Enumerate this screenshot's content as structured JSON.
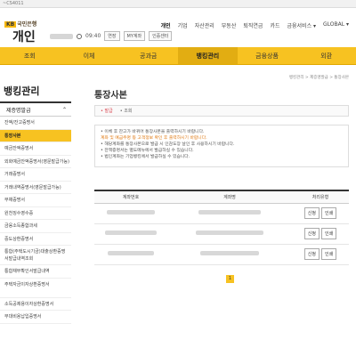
{
  "browser": {
    "url": "~CS4011"
  },
  "header": {
    "logo_badge": "KB",
    "logo_text": "국민은행",
    "brand": "개인",
    "gnb": [
      "개인",
      "기업",
      "자산관리",
      "부동산",
      "퇴직연금",
      "카드",
      "금융서비스 ▾",
      "GLOBAL ▾"
    ],
    "time": "09:40",
    "btn_extend": "연장",
    "btn_mydata": "MY계좌",
    "btn_security": "인증센터"
  },
  "mainnav": [
    "조회",
    "이체",
    "공과금",
    "뱅킹관리",
    "금융상품",
    "외환"
  ],
  "sidebar": {
    "title": "뱅킹관리",
    "section": "제증명발급",
    "items": [
      "잔액/잔고증명서",
      "통장사본",
      "예금잔액증명서",
      "외화예금잔액증명서(영문발급가능)",
      "거래증명서",
      "거래내역증명서(영문발급가능)",
      "부채증명서",
      "원천징수영수증",
      "금융소득종합과세",
      "중도상환증명서",
      "통합(주택도시기금)대출상환증명서발급내역조회",
      "통합채무확인서발급내역",
      "주택자금이자상환증명서",
      "소득공제용이자상환증명서",
      "부대비용납입증명서"
    ],
    "active_index": 1
  },
  "content": {
    "breadcrumb": "뱅킹관리 > 제증명발급 > 통장사본",
    "title": "통장사본",
    "tabs": [
      "• 발급",
      "• 조회"
    ],
    "notice": [
      "• 이체 후 잔고가 바뀌어 통장사본을 출력하시기 바랍니다.",
      "  계좌 및 예금주명 등 고객정보 확인 후 출력하시기 바랍니다.",
      "• 해당계좌를 통장사본으로 발급 시 인감도장 날인 후 사용하시기 바랍니다.",
      "• 잔액증명서는 별도메뉴에서 발급하실 수 있습니다.",
      "• 법인계좌는 기업뱅킹에서 발급하실 수 있습니다."
    ],
    "table": {
      "headers": [
        "계좌번호",
        "계좌명",
        "처리유형"
      ],
      "rows": [
        {
          "btn1": "신청",
          "btn2": "인쇄"
        },
        {
          "btn1": "신청",
          "btn2": "인쇄"
        },
        {
          "btn1": "신청",
          "btn2": "인쇄"
        }
      ]
    },
    "page": "1"
  }
}
